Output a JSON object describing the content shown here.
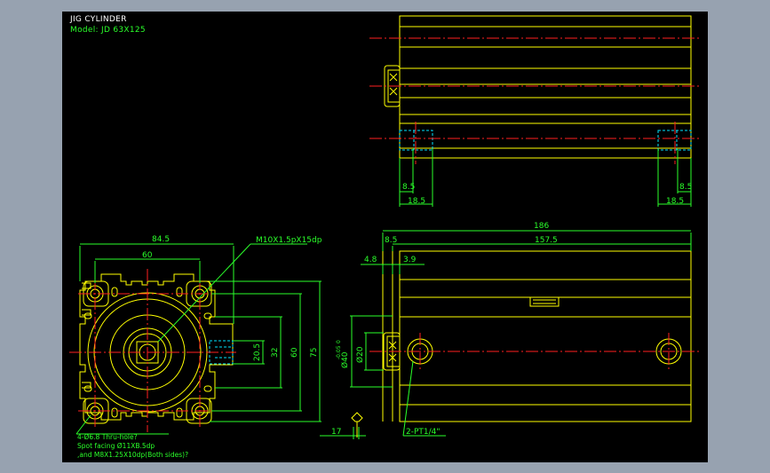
{
  "drawing": {
    "title": "JIG CYLINDER",
    "model": "Model: JD 63X125",
    "colors": {
      "background": "#000000",
      "frame": "#97a2b0",
      "outline": "#ffff00",
      "centerline": "#ff2020",
      "hidden": "#00e5ff",
      "dimension": "#2aff2a"
    }
  },
  "top_view": {
    "dims": {
      "left_inner": "8.5",
      "left_outer": "18.5",
      "right_inner": "8.5",
      "right_outer": "18.5"
    }
  },
  "front_view": {
    "dims": {
      "width": "84.5",
      "bolt_pitch": "60",
      "port_thread": "M10X1.5pX15dp",
      "h_small": "20.5",
      "h_mid": "32",
      "h_bolt": "60",
      "h_total": "75"
    },
    "notes": [
      "4-Ø6.8 Thru-hole?",
      "Spot facing Ø11XB.5dp",
      ",and M8X1.25X10dp(Both sides)?"
    ]
  },
  "side_view": {
    "dims": {
      "total_length": "186",
      "cap": "8.5",
      "body": "157.5",
      "rod_a": "4.8",
      "rod_b": "3.9",
      "rod_dia": "Ø20",
      "boss_dia": "Ø40",
      "tol_top": "0",
      "tol_bot": "-0.05",
      "rod_end": "17",
      "port": "2-PT1/4\""
    }
  }
}
